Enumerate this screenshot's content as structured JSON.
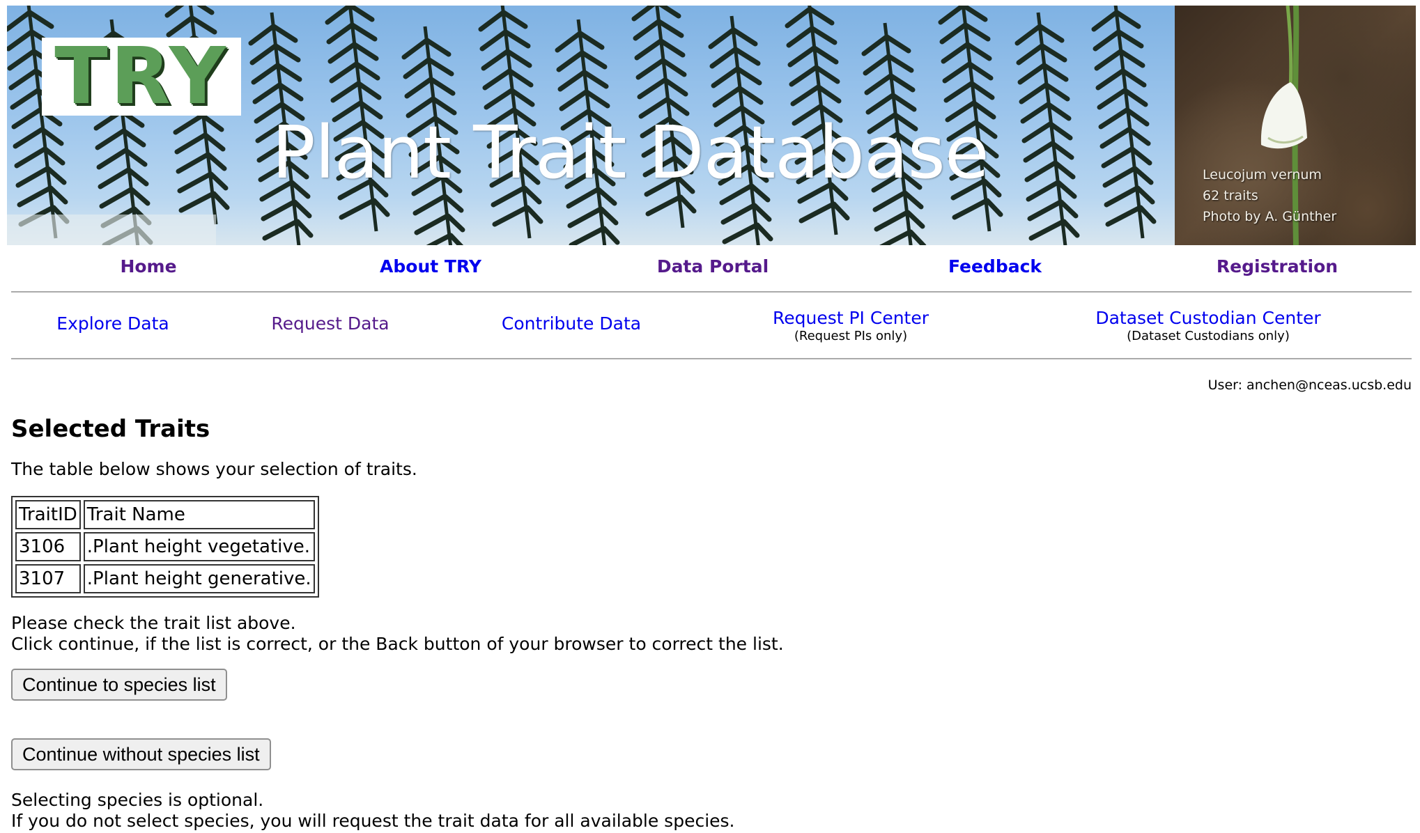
{
  "banner": {
    "logo_text": "TRY",
    "title": "Plant Trait Database",
    "photo_caption": {
      "species": "Leucojum vernum",
      "traits": "62 traits",
      "credit": "Photo by A. Günther"
    }
  },
  "main_nav": {
    "home": "Home",
    "about": "About TRY",
    "data_portal": "Data Portal",
    "feedback": "Feedback",
    "registration": "Registration"
  },
  "sub_nav": {
    "explore": "Explore Data",
    "request": "Request Data",
    "contribute": "Contribute Data",
    "pi_center": "Request PI Center",
    "pi_center_note": "(Request PIs only)",
    "custodian_center": "Dataset Custodian Center",
    "custodian_center_note": "(Dataset Custodians only)"
  },
  "user": {
    "label": "User: anchen@nceas.ucsb.edu"
  },
  "page": {
    "title": "Selected Traits",
    "intro": "The table below shows your selection of traits."
  },
  "traits_table": {
    "headers": [
      "TraitID",
      "Trait Name"
    ],
    "rows": [
      [
        "3106",
        ".Plant height vegetative."
      ],
      [
        "3107",
        ".Plant height generative."
      ]
    ]
  },
  "instructions": {
    "line1": "Please check the trait list above.",
    "line2": "Click continue, if the list is correct, or the Back button of your browser to correct the list."
  },
  "buttons": {
    "continue_species": "Continue to species list",
    "continue_without": "Continue without species list"
  },
  "optional_note": {
    "line1": "Selecting species is optional.",
    "line2": "If you do not select species, you will request the trait data for all available species."
  },
  "colors": {
    "link_visited": "#551a8b",
    "link_unvisited": "#0000ee",
    "logo_green": "#5c9e58",
    "sky_blue": "#9cc5ec"
  }
}
